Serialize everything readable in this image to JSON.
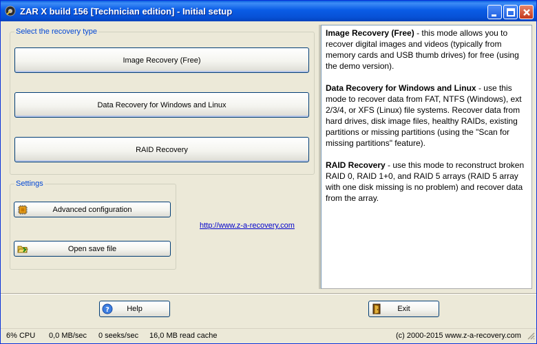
{
  "window": {
    "title": "ZAR X build 156 [Technician edition] - Initial setup",
    "icon": "zar-app-icon",
    "controls": [
      "minimize",
      "maximize",
      "close"
    ]
  },
  "recovery_group": {
    "label": "Select the recovery type",
    "buttons": [
      {
        "label": "Image Recovery (Free)"
      },
      {
        "label": "Data Recovery for Windows and Linux"
      },
      {
        "label": "RAID Recovery"
      }
    ]
  },
  "settings_group": {
    "label": "Settings",
    "advanced_label": "Advanced configuration",
    "advanced_icon": "chip-icon",
    "open_label": "Open save file",
    "open_icon": "folder-icon"
  },
  "link": "http://www.z-a-recovery.com",
  "description": [
    {
      "title": "Image Recovery (Free)",
      "text": " - this mode allows you to recover digital images and videos (typically from memory cards and USB thumb drives) for free (using the demo version)."
    },
    {
      "title": "Data Recovery for Windows and Linux",
      "text": " - use this mode to recover data from FAT, NTFS (Windows), ext 2/3/4, or XFS (Linux) file systems. Recover data from hard drives, disk image files, healthy RAIDs, existing partitions or missing partitions (using the \"Scan for missing partitions\" feature)."
    },
    {
      "title": "RAID Recovery",
      "text": " - use this mode to reconstruct broken RAID 0, RAID 1+0, and RAID 5 arrays (RAID 5 array with one disk missing is no problem) and recover data from the array."
    }
  ],
  "footer": {
    "help_label": "Help",
    "help_icon": "help-icon",
    "exit_label": "Exit",
    "exit_icon": "exit-door-icon"
  },
  "status": {
    "cpu": "6% CPU",
    "throughput": "0,0 MB/sec",
    "seeks": "0 seeks/sec",
    "cache": "16,0 MB read cache",
    "copyright": "(c) 2000-2015 www.z-a-recovery.com"
  },
  "colors": {
    "titlebar": "#0751d6",
    "group_label": "#0046d5",
    "link": "#0000cc",
    "face": "#ece9d8"
  }
}
